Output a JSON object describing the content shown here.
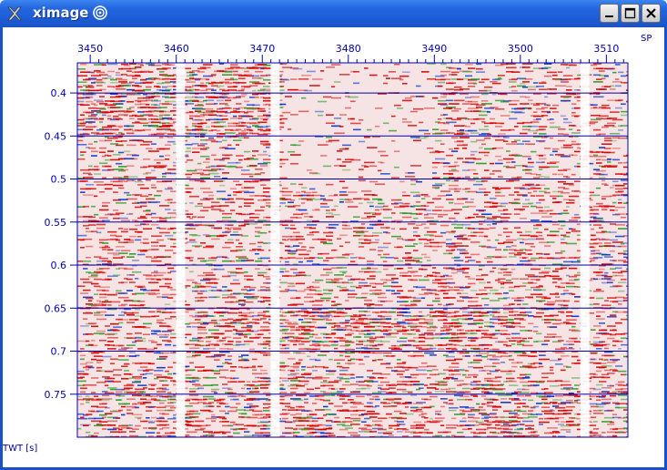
{
  "window": {
    "title": "ximage",
    "buttons": {
      "minimize": "minimize",
      "maximize": "maximize",
      "close": "close"
    }
  },
  "chart_data": {
    "type": "heatmap",
    "title": "",
    "xlabel": "SP",
    "ylabel": "TWT [s]",
    "xlim": [
      3448.5,
      3512.5
    ],
    "ylim": [
      0.8,
      0.365
    ],
    "x_ticks": [
      "3450",
      "3460",
      "3470",
      "3480",
      "3490",
      "3500",
      "3510"
    ],
    "x_tick_values": [
      3450,
      3460,
      3470,
      3480,
      3490,
      3500,
      3510
    ],
    "y_ticks": [
      "0.4",
      "0.45",
      "0.5",
      "0.55",
      "0.6",
      "0.65",
      "0.7",
      "0.75"
    ],
    "y_tick_values": [
      0.4,
      0.45,
      0.5,
      0.55,
      0.6,
      0.65,
      0.7,
      0.75
    ],
    "grid": "horizontal lines at y ticks",
    "colormap": {
      "positive": "#d40000",
      "neutral": "#ffffff",
      "negative": "#0033cc",
      "weak": "#2a9a2a"
    },
    "axis_color": "#0000a8",
    "blank_traces_sp": [
      3460.5,
      3471.5,
      3507.5
    ]
  }
}
